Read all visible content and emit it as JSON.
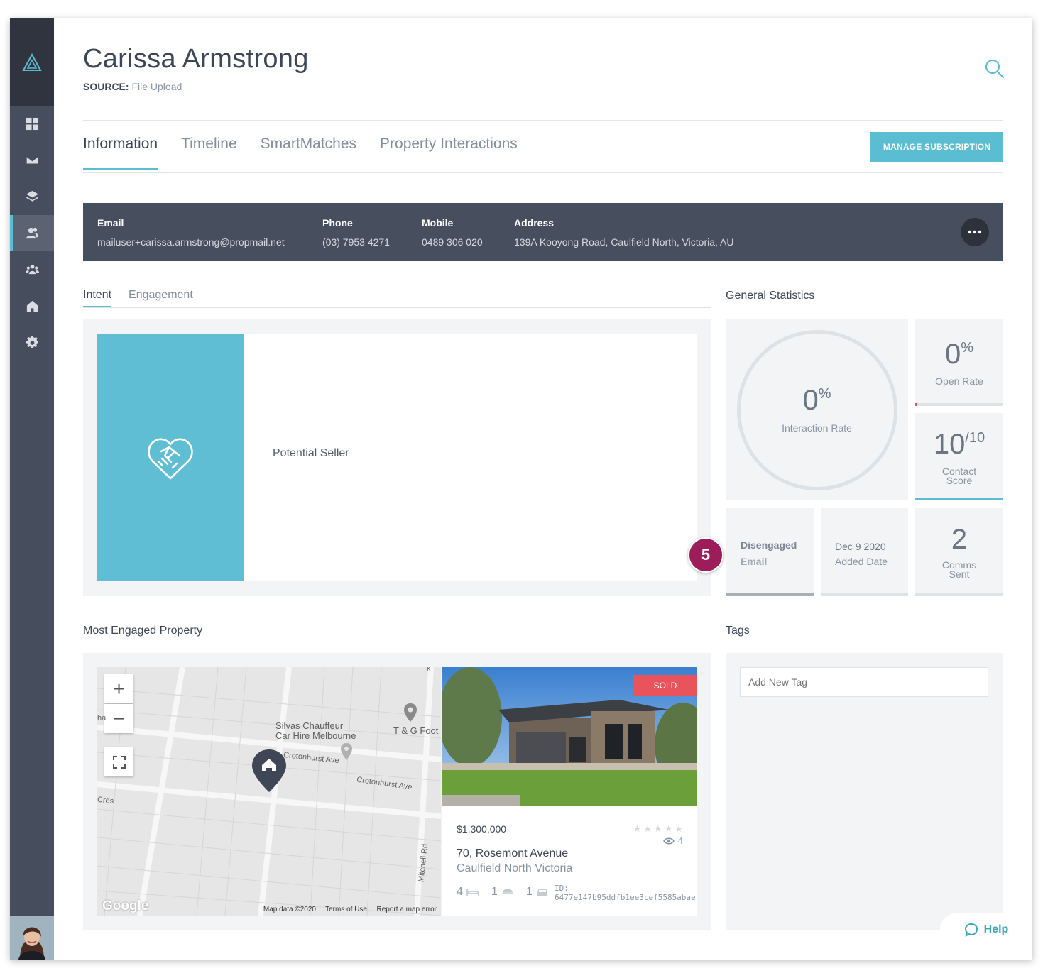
{
  "contact": {
    "name": "Carissa Armstrong",
    "source_label": "SOURCE:",
    "source_value": "File Upload"
  },
  "tabs": [
    {
      "label": "Information",
      "active": true
    },
    {
      "label": "Timeline"
    },
    {
      "label": "SmartMatches"
    },
    {
      "label": "Property Interactions"
    }
  ],
  "manage_button": "MANAGE SUBSCRIPTION",
  "contact_bar": {
    "email_label": "Email",
    "email": "mailuser+carissa.armstrong@propmail.net",
    "phone_label": "Phone",
    "phone": "(03) 7953 4271",
    "mobile_label": "Mobile",
    "mobile": "0489 306 020",
    "address_label": "Address",
    "address": "139A Kooyong Road, Caulfield North, Victoria, AU",
    "more_icon": "more-dots-icon"
  },
  "subtabs": [
    {
      "label": "Intent",
      "active": true
    },
    {
      "label": "Engagement"
    }
  ],
  "intent": {
    "icon": "handshake-icon",
    "label": "Potential Seller"
  },
  "callout_number": "5",
  "stats": {
    "title": "General Statistics",
    "interaction_rate": {
      "value": "0",
      "unit": "%",
      "label": "Interaction Rate"
    },
    "open_rate": {
      "value": "0",
      "unit": "%",
      "label": "Open Rate"
    },
    "contact_score": {
      "value": "10",
      "unit": "/10",
      "label_line1": "Contact",
      "label_line2": "Score"
    },
    "engagement": {
      "line1": "Disengaged",
      "line2": "Email"
    },
    "added": {
      "line1": "Dec 9 2020",
      "line2": "Added Date"
    },
    "comms": {
      "value": "2",
      "label_line1": "Comms",
      "label_line2": "Sent"
    }
  },
  "most_engaged_title": "Most Engaged Property",
  "tags_title": "Tags",
  "map": {
    "zoom_in": "+",
    "zoom_out": "−",
    "labels": {
      "silvas1": "Silvas Chauffeur",
      "silvas2": "Car Hire Melbourne",
      "tg": "T & G Foot",
      "crot1": "Crotonhurst Ave",
      "crot2": "Crotonhurst Ave",
      "mitchell": "Mitchell Rd",
      "res": "Cres",
      "edge": "ha",
      "k": "k"
    },
    "google": "Google",
    "map_data": "Map data ©2020",
    "terms": "Terms of Use",
    "report": "Report a map error"
  },
  "property": {
    "status": "SOLD",
    "price": "$1,300,000",
    "views": "4",
    "street": "70, Rosemont Avenue",
    "suburb": "Caulfield North Victoria",
    "beds": "4",
    "baths": "1",
    "cars": "1",
    "id_label": "ID:",
    "id": "6477e147b95ddfb1ee3cef5585abae",
    "rating": 0
  },
  "tags": {
    "placeholder": "Add New Tag"
  },
  "help": "Help",
  "colors": {
    "accent": "#5bbdd2",
    "sidebar": "#464d5c",
    "contact_bar": "#474e5d",
    "sold": "#e8535c",
    "badge": "#9c1d5a"
  }
}
